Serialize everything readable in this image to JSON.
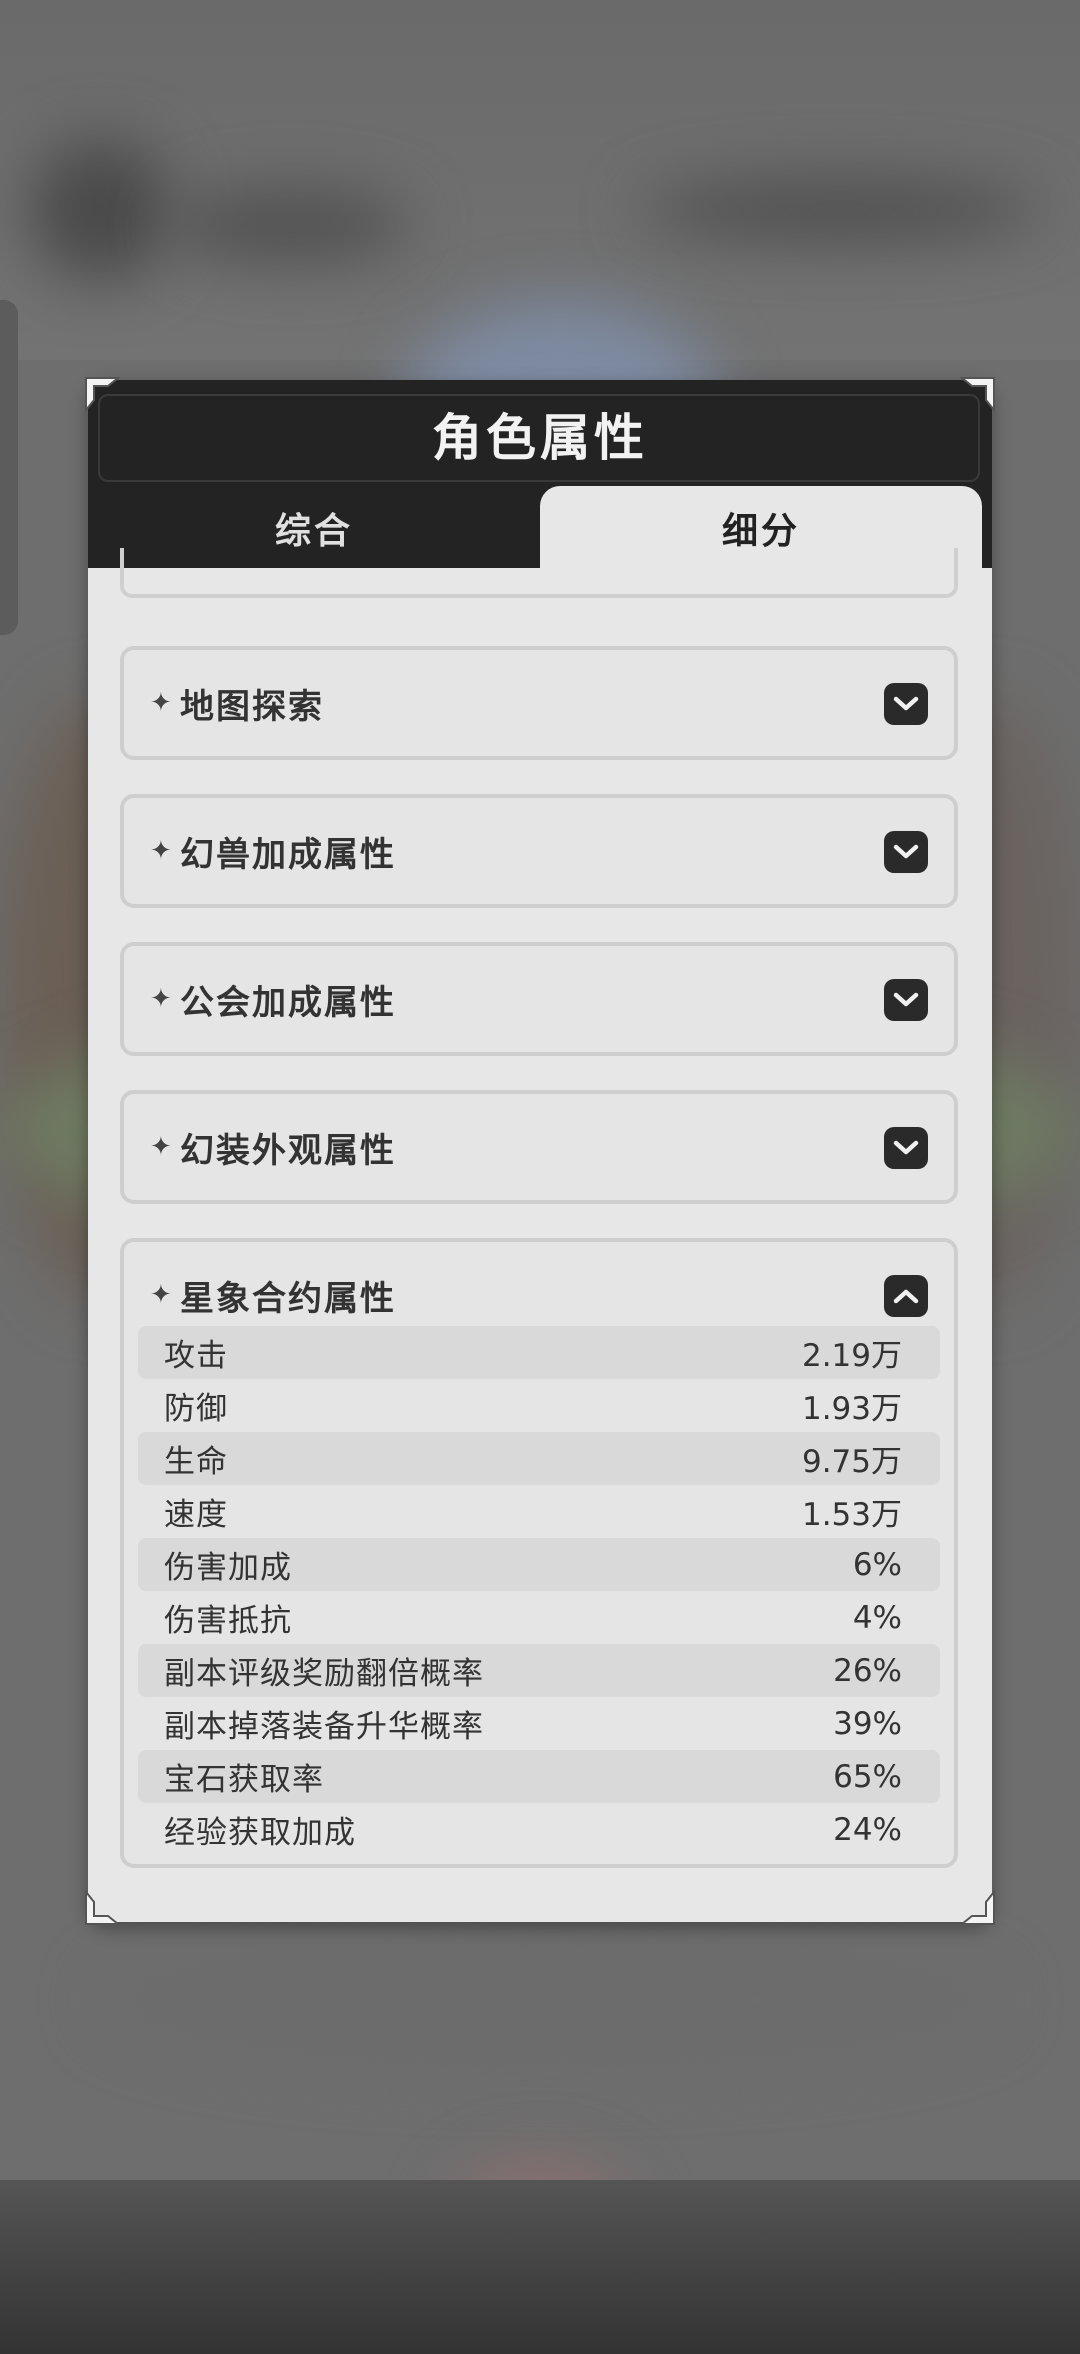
{
  "dialog": {
    "title": "角色属性",
    "tabs": [
      {
        "label": "综合",
        "active": false
      },
      {
        "label": "细分",
        "active": true
      }
    ]
  },
  "sections": [
    {
      "title": "地图探索",
      "expanded": false,
      "icon": "chevron-down-icon"
    },
    {
      "title": "幻兽加成属性",
      "expanded": false,
      "icon": "chevron-down-icon"
    },
    {
      "title": "公会加成属性",
      "expanded": false,
      "icon": "chevron-down-icon"
    },
    {
      "title": "幻装外观属性",
      "expanded": false,
      "icon": "chevron-down-icon"
    },
    {
      "title": "星象合约属性",
      "expanded": true,
      "icon": "chevron-up-icon",
      "stats": [
        {
          "label": "攻击",
          "value": "2.19万"
        },
        {
          "label": "防御",
          "value": "1.93万"
        },
        {
          "label": "生命",
          "value": "9.75万"
        },
        {
          "label": "速度",
          "value": "1.53万"
        },
        {
          "label": "伤害加成",
          "value": "6%"
        },
        {
          "label": "伤害抵抗",
          "value": "4%"
        },
        {
          "label": "副本评级奖励翻倍概率",
          "value": "26%"
        },
        {
          "label": "副本掉落装备升华概率",
          "value": "39%"
        },
        {
          "label": "宝石获取率",
          "value": "65%"
        },
        {
          "label": "经验获取加成",
          "value": "24%"
        }
      ]
    }
  ],
  "colors": {
    "title_bar": "#232323",
    "panel": "#e7e7e7",
    "row_shade": "#d9d9d9"
  }
}
